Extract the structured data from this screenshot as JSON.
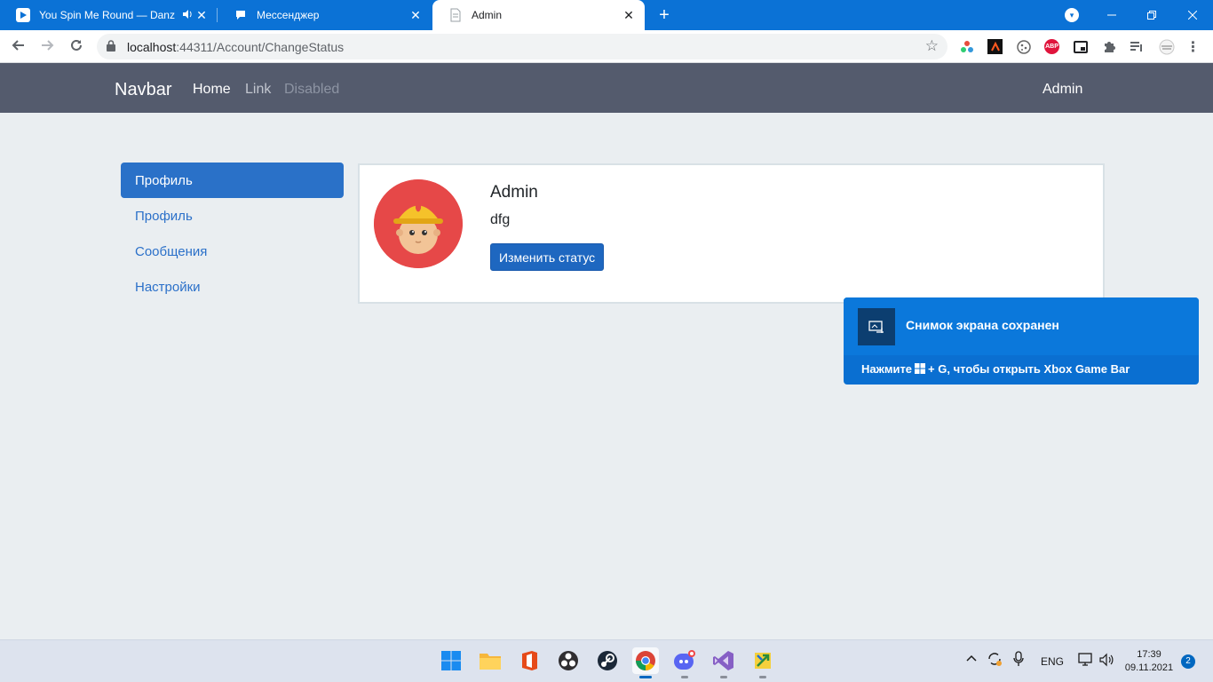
{
  "browser": {
    "tabs": [
      {
        "title": "You Spin Me Round — Danz",
        "audio": "speaker-icon",
        "active": false
      },
      {
        "title": "Мессенджер",
        "active": false
      },
      {
        "title": "Admin",
        "active": true
      }
    ],
    "url": {
      "host": "localhost",
      "rest": ":44311/Account/ChangeStatus"
    },
    "theme_color": "#0b72d6",
    "extensions": [
      "color-picker-extension-icon",
      "dark-extension-icon",
      "cookie-extension-icon",
      "adblock-plus-icon",
      "picture-in-picture-icon",
      "extensions-puzzle-icon",
      "reading-list-icon",
      "profile-avatar-icon"
    ],
    "adblock_label": "ABP"
  },
  "navbar": {
    "brand": "Navbar",
    "links": [
      {
        "label": "Home",
        "state": "active"
      },
      {
        "label": "Link",
        "state": "normal"
      },
      {
        "label": "Disabled",
        "state": "disabled"
      }
    ],
    "user": "Admin",
    "bg_color": "#545b6d"
  },
  "sidebar": {
    "items": [
      {
        "label": "Профиль",
        "active": true
      },
      {
        "label": "Профиль",
        "active": false
      },
      {
        "label": "Сообщения",
        "active": false
      },
      {
        "label": "Настройки",
        "active": false
      }
    ],
    "accent": "#2a71c8"
  },
  "profile": {
    "name": "Admin",
    "status": "dfg",
    "button_label": "Изменить статус",
    "avatar": "firefighter-avatar"
  },
  "toast": {
    "title": "Снимок экрана сохранен",
    "hint_before": "Нажмите",
    "hint_after": "+ G, чтобы открыть Xbox Game Bar"
  },
  "taskbar": {
    "apps": [
      "start-icon",
      "file-explorer-icon",
      "office-icon",
      "obs-icon",
      "steam-icon",
      "chrome-icon",
      "discord-icon",
      "visual-studio-icon",
      "installer-icon"
    ],
    "language": "ENG",
    "time": "17:39",
    "date": "09.11.2021",
    "notifications": "2"
  }
}
